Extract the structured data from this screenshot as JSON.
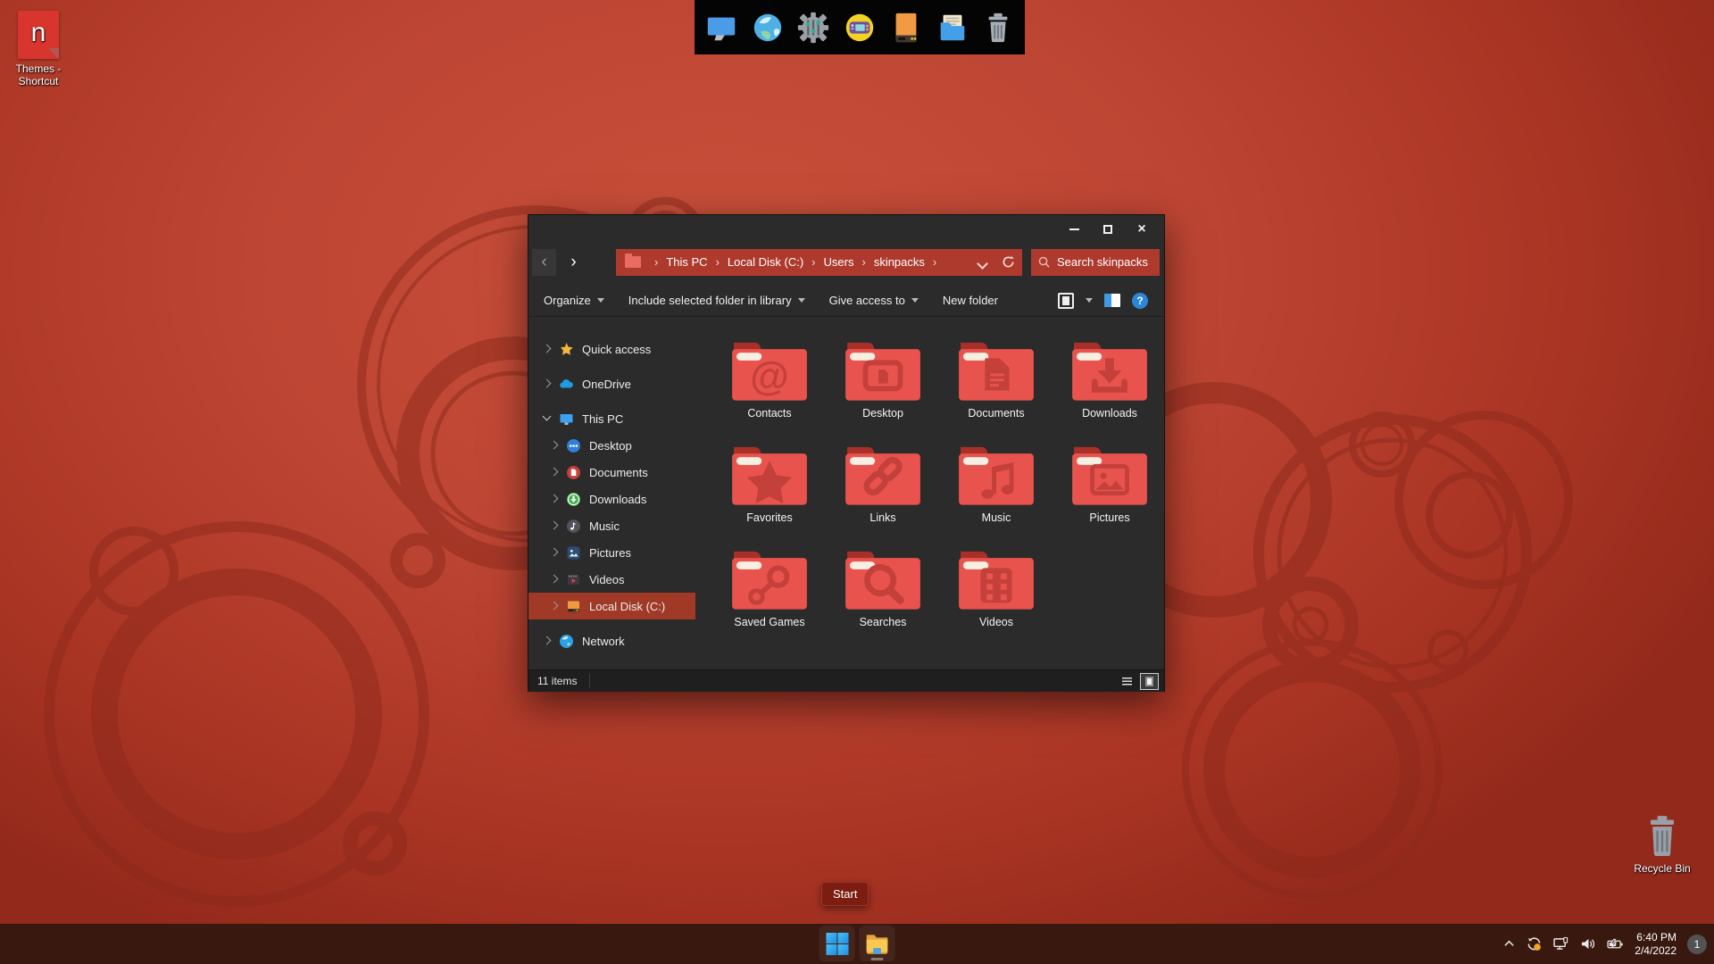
{
  "desktop": {
    "themes_shortcut_label": "Themes - Shortcut",
    "themes_shortcut_glyph": "n",
    "recycle_bin_label": "Recycle Bin",
    "start_tooltip": "Start",
    "dock_icons": [
      "display",
      "globe",
      "settings-gear",
      "games",
      "external-drive",
      "file-manager",
      "trash"
    ]
  },
  "explorer": {
    "glyphs": {
      "back": "‹",
      "forward": "›",
      "crumb_sep": "›"
    },
    "breadcrumb": [
      "This PC",
      "Local Disk (C:)",
      "Users",
      "skinpacks"
    ],
    "search_placeholder": "Search skinpacks",
    "toolbar": {
      "organize": "Organize",
      "include_library": "Include selected folder in library",
      "give_access": "Give access to",
      "new_folder": "New folder",
      "help": "?"
    },
    "sidebar": {
      "quick_access": "Quick access",
      "onedrive": "OneDrive",
      "this_pc": "This PC",
      "desktop": "Desktop",
      "documents": "Documents",
      "downloads": "Downloads",
      "music": "Music",
      "pictures": "Pictures",
      "videos": "Videos",
      "local_disk": "Local Disk (C:)",
      "network": "Network"
    },
    "files": [
      {
        "name": "Contacts"
      },
      {
        "name": "Desktop"
      },
      {
        "name": "Documents"
      },
      {
        "name": "Downloads"
      },
      {
        "name": "Favorites"
      },
      {
        "name": "Links"
      },
      {
        "name": "Music"
      },
      {
        "name": "Pictures"
      },
      {
        "name": "Saved Games"
      },
      {
        "name": "Searches"
      },
      {
        "name": "Videos"
      }
    ],
    "status_text": "11 items"
  },
  "taskbar": {
    "time": "6:40 PM",
    "date": "2/4/2022",
    "notification_badge": "1"
  },
  "colors": {
    "accent_red": "#ae3a2e",
    "selection_red": "#a03a27",
    "folder_body": "#e9534e",
    "folder_emblem": "#c4403a",
    "window_bg": "#2b2b2b",
    "taskbar_bg": "#39190f",
    "desktop_red": "#bd4533",
    "dock_bg": "#040404"
  }
}
